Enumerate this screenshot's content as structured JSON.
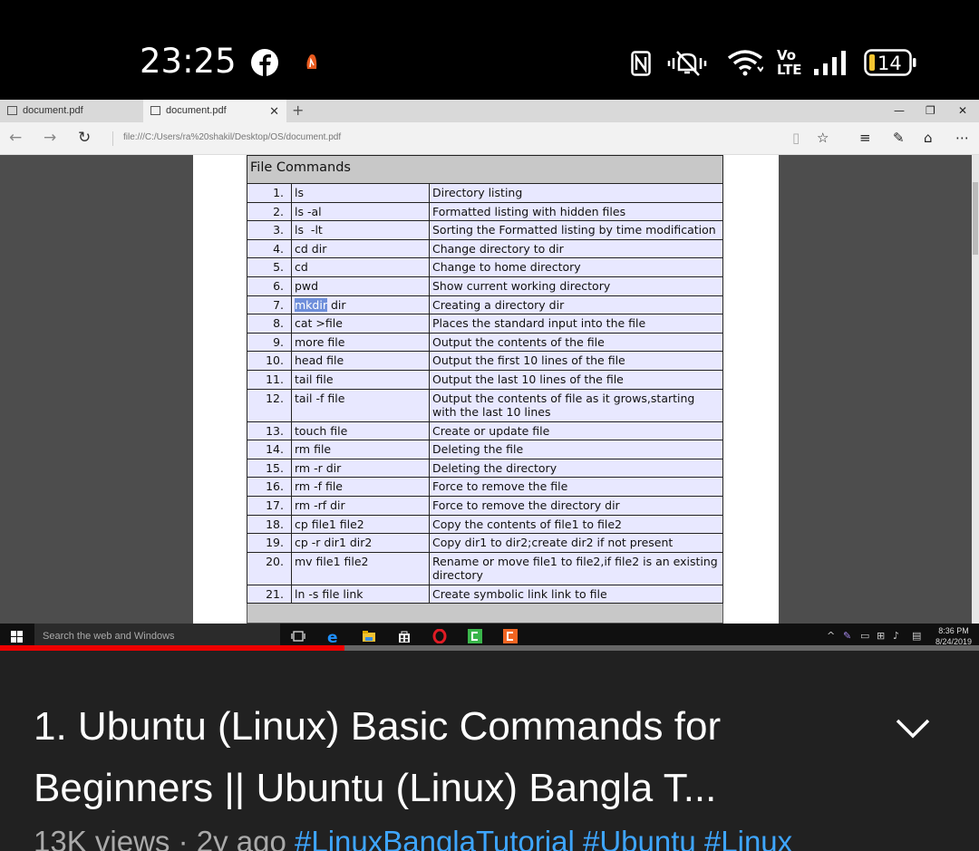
{
  "status_bar": {
    "time": "23:25",
    "battery": "14",
    "icons": [
      "facebook-icon",
      "app-notification-icon",
      "nfc-icon",
      "mute-icon",
      "wifi-icon",
      "volte-icon",
      "signal-icon",
      "battery-icon"
    ]
  },
  "browser": {
    "tabs": [
      {
        "label": "document.pdf",
        "active": false
      },
      {
        "label": "document.pdf",
        "active": true
      }
    ],
    "url": "file:///C:/Users/ra%20shakil/Desktop/OS/document.pdf"
  },
  "pdf": {
    "table_title": "File Commands",
    "rows": [
      {
        "num": "1.",
        "cmd": "ls",
        "desc": "Directory listing"
      },
      {
        "num": "2.",
        "cmd": "ls -al",
        "desc": "Formatted listing with hidden files"
      },
      {
        "num": "3.",
        "cmd": "ls  -lt",
        "desc": "Sorting the Formatted listing by time modification"
      },
      {
        "num": "4.",
        "cmd": "cd dir",
        "desc": "Change directory to dir"
      },
      {
        "num": "5.",
        "cmd": "cd",
        "desc": "Change to home directory"
      },
      {
        "num": "6.",
        "cmd": "pwd",
        "desc": "Show current working directory"
      },
      {
        "num": "7.",
        "cmd_selected": "mkdir",
        "cmd_rest": " dir",
        "desc": "Creating a directory dir"
      },
      {
        "num": "8.",
        "cmd": "cat >file",
        "desc": "Places the standard input into the file"
      },
      {
        "num": "9.",
        "cmd": "more file",
        "desc": "Output the contents of the file"
      },
      {
        "num": "10.",
        "cmd": "head file",
        "desc": "Output the first 10 lines of the file"
      },
      {
        "num": "11.",
        "cmd": "tail file",
        "desc": "Output the last 10 lines of the file"
      },
      {
        "num": "12.",
        "cmd": "tail -f file",
        "desc": "Output the contents of file as it grows,starting with the last 10 lines"
      },
      {
        "num": "13.",
        "cmd": "touch file",
        "desc": "Create or update file"
      },
      {
        "num": "14.",
        "cmd": "rm file",
        "desc": "Deleting the file"
      },
      {
        "num": "15.",
        "cmd": "rm -r dir",
        "desc": "Deleting the directory"
      },
      {
        "num": "16.",
        "cmd": "rm -f file",
        "desc": "Force to remove the file"
      },
      {
        "num": "17.",
        "cmd": "rm -rf dir",
        "desc": "Force to remove the directory dir"
      },
      {
        "num": "18.",
        "cmd": "cp file1 file2",
        "desc": "Copy the contents of file1 to file2"
      },
      {
        "num": "19.",
        "cmd": "cp -r dir1 dir2",
        "desc": "Copy dir1 to dir2;create dir2 if not present"
      },
      {
        "num": "20.",
        "cmd": "mv file1 file2",
        "desc": "Rename or move file1 to file2,if file2 is an existing directory"
      },
      {
        "num": "21.",
        "cmd": "ln -s file link",
        "desc": "Create symbolic link link to file"
      }
    ]
  },
  "taskbar": {
    "search_placeholder": "Search the web and Windows",
    "time": "8:36 PM",
    "date": "8/24/2019"
  },
  "video": {
    "progress_fraction": 0.352,
    "title": "1. Ubuntu (Linux) Basic Commands for Beginners || Ubuntu (Linux) Bangla T...",
    "meta_prefix": "13K views · 2y ago ",
    "hashtags": [
      "#LinuxBanglaTutorial",
      "#Ubuntu",
      "#Linux"
    ]
  }
}
